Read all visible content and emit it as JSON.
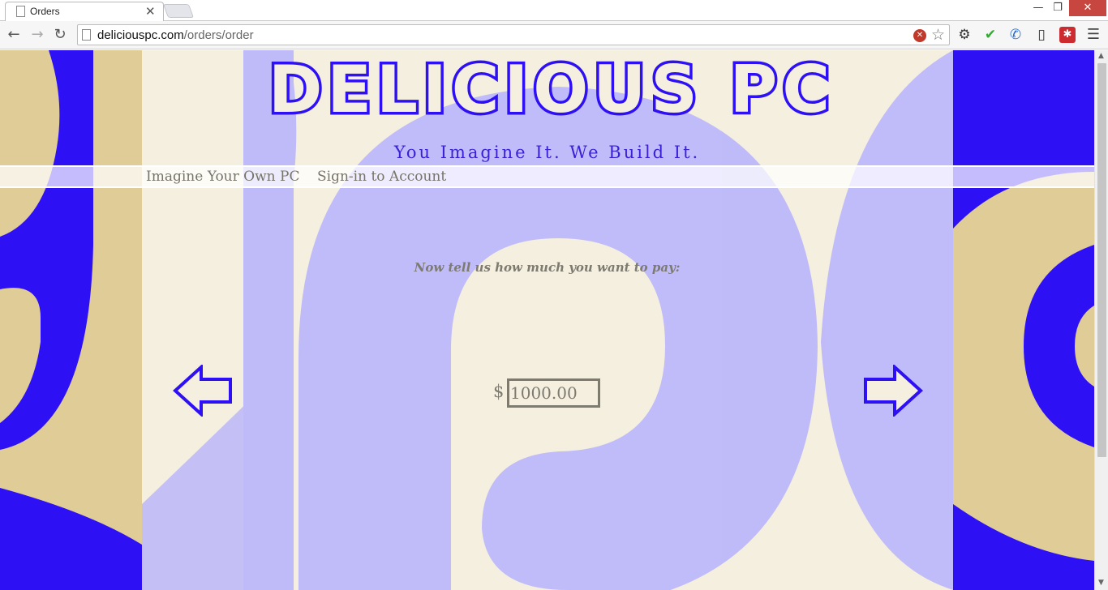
{
  "browser": {
    "tab_title": "Orders",
    "tab_close_glyph": "✕",
    "url_host": "deliciouspc.com",
    "url_path": "/orders/order",
    "window_controls": {
      "minimize": "—",
      "maximize": "❐",
      "close": "✕"
    },
    "nav_icons": [
      "back-arrow-icon",
      "forward-arrow-icon",
      "reload-icon"
    ],
    "extension_icons": [
      "gear-icon",
      "check-icon",
      "phone-icon",
      "device-icon",
      "lastpass-icon",
      "menu-icon"
    ]
  },
  "site": {
    "logo_text": "DELICIOUS PC",
    "tagline": "You Imagine It. We Build It.",
    "nav": [
      {
        "label": "Imagine Your Own PC"
      },
      {
        "label": "Sign-in to Account"
      }
    ],
    "colors": {
      "brand_blue": "#3a1fd6",
      "royal_blue": "#2e10f5",
      "lavender": "#bdb8fa",
      "tan": "#dfcc97",
      "cream": "#f5efdf"
    }
  },
  "order": {
    "prompt": "Now tell us how much you want to pay:",
    "currency_symbol": "$",
    "price_value": "1000.00",
    "prev_icon": "left-arrow-icon",
    "next_icon": "right-arrow-icon"
  }
}
